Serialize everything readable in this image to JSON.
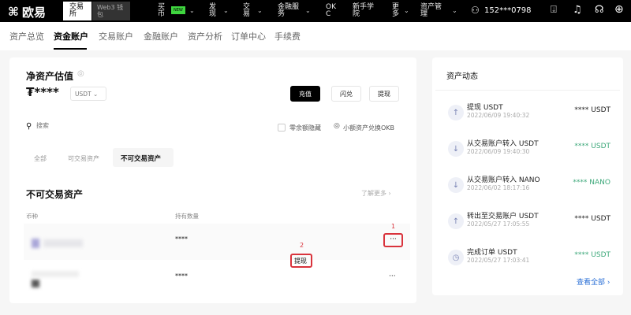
{
  "topbar": {
    "logo": "欧易",
    "tabs": [
      "交易所",
      "Web3 钱包"
    ],
    "menu": [
      "买币",
      "发现",
      "交易",
      "金融服务",
      "OKC",
      "新手学院",
      "更多",
      "资产管理"
    ],
    "new_badge": "NEW",
    "user": "152***0798"
  },
  "subnav": [
    "资产总览",
    "资金账户",
    "交易账户",
    "金融账户",
    "资产分析",
    "订单中心",
    "手续费"
  ],
  "main": {
    "title": "净资产估值",
    "value": "₮****",
    "currency": "USDT",
    "buttons": [
      "充值",
      "闪兑",
      "提现"
    ],
    "search_placeholder": "搜索",
    "hide_zero": "零余额隐藏",
    "convert": "小额资产兑换OKB",
    "filters": [
      "全部",
      "可交易资产",
      "不可交易资产"
    ],
    "section_title": "不可交易资产",
    "learn_more": "了解更多",
    "columns": [
      "币种",
      "持有数量"
    ],
    "rows": [
      {
        "amount": "****"
      },
      {
        "amount": "****"
      }
    ],
    "menu_popup": "提现",
    "annotations": [
      "1",
      "2"
    ]
  },
  "activity": {
    "title": "资产动态",
    "items": [
      {
        "title": "提现 USDT",
        "date": "2022/06/09 19:40:32",
        "amount": "**** USDT",
        "icon": "↑"
      },
      {
        "title": "从交易账户转入 USDT",
        "date": "2022/06/09 19:40:30",
        "amount": "**** USDT",
        "icon": "↓"
      },
      {
        "title": "从交易账户转入 NANO",
        "date": "2022/06/02 18:17:16",
        "amount": "**** NANO",
        "icon": "↓"
      },
      {
        "title": "转出至交易账户 USDT",
        "date": "2022/05/27 17:05:55",
        "amount": "**** USDT",
        "icon": "↑"
      },
      {
        "title": "完成订单 USDT",
        "date": "2022/05/27 17:03:41",
        "amount": "**** USDT",
        "icon": "◷"
      }
    ],
    "view_all": "查看全部"
  }
}
